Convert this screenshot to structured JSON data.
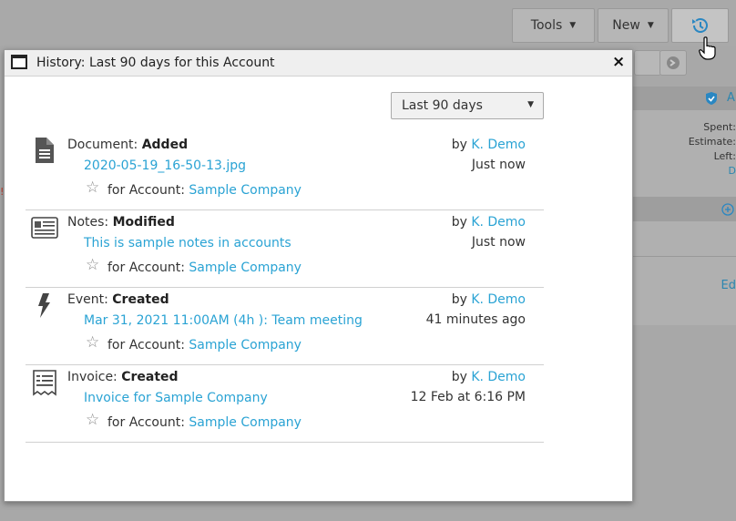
{
  "toolbar": {
    "tools_label": "Tools",
    "new_label": "New"
  },
  "background_panel": {
    "header_text": "A",
    "spent": "Spent:",
    "estimate": "Estimate:",
    "left": "Left:",
    "d_link": "D",
    "edit_link": "Ed"
  },
  "dialog": {
    "title": "History: Last 90 days for this Account",
    "close_label": "×",
    "period_select": {
      "selected": "Last 90 days"
    },
    "entries": [
      {
        "icon": "document-icon",
        "type": "Document: ",
        "action": "Added",
        "subject": "2020-05-19_16-50-13.jpg",
        "for_label": "for Account: ",
        "account": "Sample Company",
        "by_label": "by ",
        "user": "K. Demo",
        "when": "Just now"
      },
      {
        "icon": "notes-icon",
        "type": "Notes: ",
        "action": "Modified",
        "subject": "This is sample notes in accounts",
        "for_label": "for Account: ",
        "account": "Sample Company",
        "by_label": "by ",
        "user": "K. Demo",
        "when": "Just now"
      },
      {
        "icon": "lightning-icon",
        "type": "Event: ",
        "action": "Created",
        "subject": "Mar 31, 2021 11:00AM (4h ): Team meeting",
        "for_label": "for Account: ",
        "account": "Sample Company",
        "by_label": "by ",
        "user": "K. Demo",
        "when": "41 minutes ago"
      },
      {
        "icon": "invoice-icon",
        "type": "Invoice: ",
        "action": "Created",
        "subject": "Invoice for Sample Company",
        "for_label": "for Account: ",
        "account": "Sample Company",
        "by_label": "by ",
        "user": "K. Demo",
        "when": "12 Feb at 6:16 PM"
      }
    ]
  },
  "colors": {
    "link": "#2aa3d4",
    "overlay": "#a8a8a8"
  }
}
